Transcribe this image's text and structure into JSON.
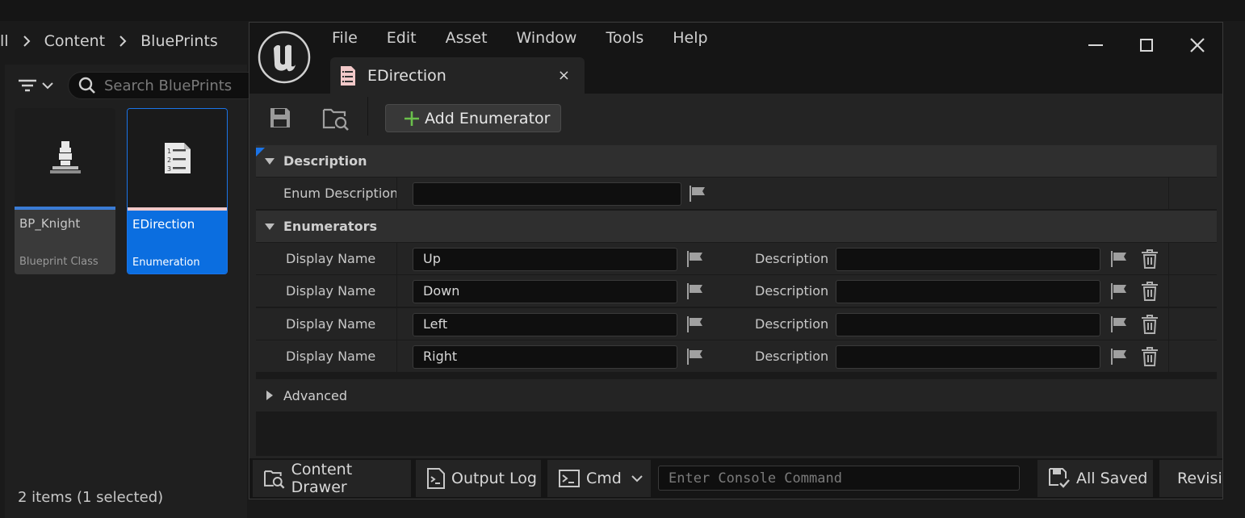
{
  "content_browser": {
    "breadcrumb": [
      "ll",
      "Content",
      "BluePrints"
    ],
    "search_placeholder": "Search BluePrints",
    "assets": [
      {
        "name": "BP_Knight",
        "type": "Blueprint Class",
        "icon": "blueprint-class-icon"
      },
      {
        "name": "EDirection",
        "type": "Enumeration",
        "icon": "enumeration-icon",
        "selected": true
      }
    ],
    "items_count": "2 items (1 selected)"
  },
  "window": {
    "menu": [
      "File",
      "Edit",
      "Asset",
      "Window",
      "Tools",
      "Help"
    ],
    "tab_title": "EDirection",
    "tab_close": "×",
    "toolbar": {
      "add_enumerator": "Add Enumerator"
    },
    "details": {
      "description_section": "Description",
      "enum_description_label": "Enum Description",
      "enum_description_value": "",
      "enumerators_section": "Enumerators",
      "enumerators": [
        {
          "display_name_label": "Display Name",
          "display_name": "Up",
          "description_label": "Description",
          "description": ""
        },
        {
          "display_name_label": "Display Name",
          "display_name": "Down",
          "description_label": "Description",
          "description": ""
        },
        {
          "display_name_label": "Display Name",
          "display_name": "Left",
          "description_label": "Description",
          "description": ""
        },
        {
          "display_name_label": "Display Name",
          "display_name": "Right",
          "description_label": "Description",
          "description": ""
        }
      ],
      "advanced_section": "Advanced"
    },
    "statusbar": {
      "content_drawer": "Content Drawer",
      "output_log": "Output Log",
      "cmd": "Cmd",
      "console_placeholder": "Enter Console Command",
      "all_saved": "All Saved",
      "revision": "Revision Control"
    }
  },
  "colors": {
    "accent": "#0b6ee0",
    "selection_border": "#1b74e8",
    "add_icon": "#6abf4b"
  }
}
